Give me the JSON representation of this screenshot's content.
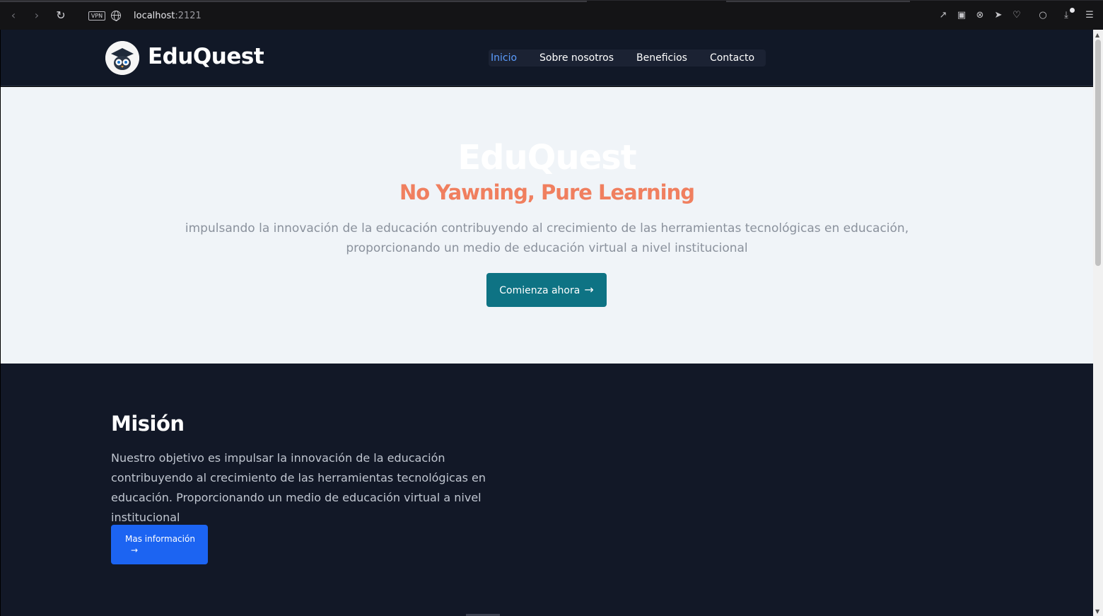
{
  "browser": {
    "vpn_label": "VPN",
    "url_host": "localhost",
    "url_port": ":2121",
    "icons": [
      "back-icon",
      "forward-icon",
      "reload-icon",
      "vpn-icon",
      "site-info-icon",
      "share-icon",
      "camera-icon",
      "shield-icon",
      "send-icon",
      "heart-icon",
      "profile-icon",
      "download-icon",
      "menu-icon"
    ]
  },
  "header": {
    "brand": "EduQuest",
    "nav": [
      {
        "label": "Inicio",
        "active": true
      },
      {
        "label": "Sobre nosotros",
        "active": false
      },
      {
        "label": "Beneficios",
        "active": false
      },
      {
        "label": "Contacto",
        "active": false
      }
    ]
  },
  "hero": {
    "title": "EduQuest",
    "tagline": "No Yawning, Pure Learning",
    "description": "impulsando la innovación de la educación contribuyendo al crecimiento de las herramientas tecnológicas en educación, proporcionando un medio de educación virtual a nivel institucional",
    "cta_label": "Comienza ahora",
    "cta_arrow": "→"
  },
  "mission": {
    "title": "Misión",
    "text": "Nuestro objetivo es impulsar la innovación de la educación contribuyendo al crecimiento de las herramientas tecnológicas en educación. Proporcionando un medio de educación virtual a nivel institucional",
    "button_label": "Mas información",
    "button_arrow": "→"
  },
  "colors": {
    "header_bg": "#111827",
    "hero_bg": "#f0f4f8",
    "tagline": "#f07f5f",
    "cta_bg": "#0e7384",
    "mission_bg": "#121827",
    "mission_btn_bg": "#1c64f2",
    "nav_active": "#5b9dff"
  }
}
